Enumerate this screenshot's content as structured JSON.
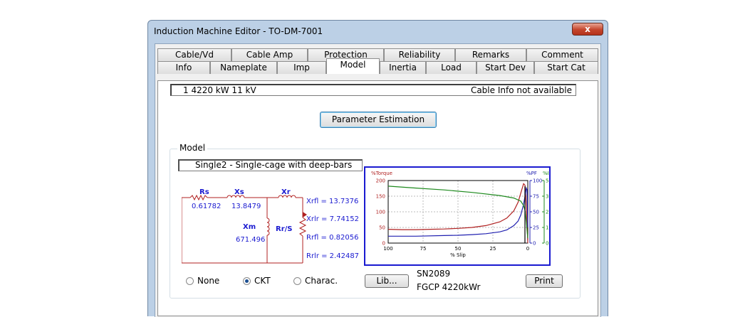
{
  "window": {
    "title": "Induction Machine Editor - TO-DM-7001",
    "close_glyph": "x"
  },
  "tabs_row1": [
    "Cable/Vd",
    "Cable Amp",
    "Protection",
    "Reliability",
    "Remarks",
    "Comment"
  ],
  "tabs_row2": [
    "Info",
    "Nameplate",
    "Imp",
    "Model",
    "Inertia",
    "Load",
    "Start Dev",
    "Start Cat"
  ],
  "active_tab": "Model",
  "info_bar": {
    "left": "1   4220 kW   11 kV",
    "right": "Cable Info not available"
  },
  "param_button": "Parameter Estimation",
  "model_group": {
    "label": "Model",
    "model_name": "Single2 - Single-cage with deep-bars"
  },
  "circuit": {
    "rs_label": "Rs",
    "rs_value": "0.61782",
    "xs_label": "Xs",
    "xs_value": "13.8479",
    "xr_label": "Xr",
    "xm_label": "Xm",
    "xm_value": "671.496",
    "rr_label": "Rr/S",
    "xrfl": "Xrfl = 13.7376",
    "xrlr": "Xrlr = 7.74152",
    "rrfl": "Rrfl = 0.82056",
    "rrlr": "Rrlr = 2.42487"
  },
  "chart_data": {
    "type": "line",
    "xlabel": "% Slip",
    "x_ticks": [
      "100",
      "75",
      "50",
      "25",
      "0"
    ],
    "xlim": [
      100,
      0
    ],
    "torque_axis": {
      "label": "%Torque",
      "ticks": [
        "0",
        "50",
        "100",
        "150",
        "200"
      ],
      "ylim": [
        0,
        200
      ],
      "color": "#b02020"
    },
    "pf_axis": {
      "label": "%PF",
      "ticks": [
        "0",
        "25",
        "50",
        "75",
        "100"
      ],
      "ylim": [
        0,
        100
      ],
      "color": "#2020b0"
    },
    "current_axis": {
      "label": "%I",
      "ticks": [
        "0",
        "125",
        "250",
        "375",
        "500"
      ],
      "ylim": [
        0,
        500
      ],
      "color": "#1e8a1e"
    },
    "series": [
      {
        "axis": "torque",
        "color": "#b02020",
        "x": [
          100,
          90,
          80,
          70,
          60,
          50,
          40,
          30,
          20,
          15,
          10,
          7,
          5,
          3,
          2,
          1,
          0
        ],
        "y": [
          44,
          43,
          43,
          44,
          45,
          47,
          50,
          56,
          68,
          80,
          103,
          130,
          160,
          190,
          185,
          120,
          0
        ]
      },
      {
        "axis": "pf",
        "color": "#2020b0",
        "x": [
          100,
          80,
          60,
          50,
          40,
          30,
          20,
          15,
          10,
          7,
          5,
          3,
          2,
          1,
          0.5,
          0
        ],
        "y": [
          11,
          11,
          12,
          12.5,
          13.5,
          15,
          18,
          21,
          28,
          35,
          45,
          62,
          75,
          88,
          85,
          25
        ]
      },
      {
        "axis": "current",
        "color": "#1e8a1e",
        "x": [
          100,
          80,
          60,
          40,
          20,
          10,
          5,
          3,
          2,
          1,
          0.5,
          0
        ],
        "y": [
          455,
          440,
          425,
          405,
          380,
          360,
          335,
          300,
          260,
          170,
          100,
          40
        ]
      }
    ]
  },
  "radios": [
    {
      "label": "None",
      "selected": false
    },
    {
      "label": "CKT",
      "selected": true
    },
    {
      "label": "Charac.",
      "selected": false
    }
  ],
  "lib_button": "Lib...",
  "library": {
    "line1": "SN2089",
    "line2": "FGCP  4220kWr"
  },
  "print_button": "Print"
}
